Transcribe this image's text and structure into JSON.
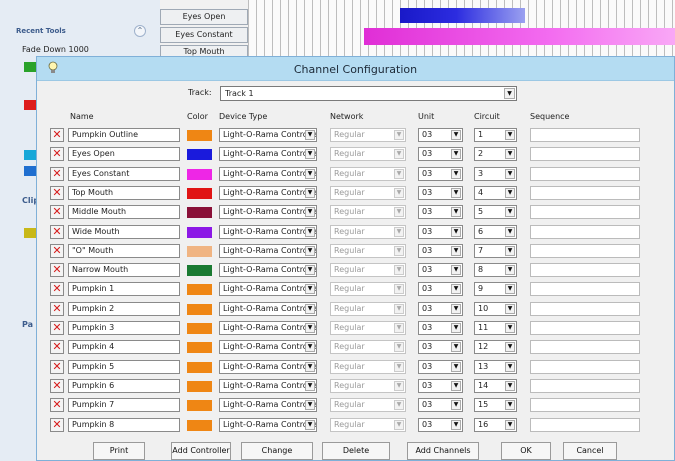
{
  "background": {
    "recent_tools_title": "Recent Tools",
    "recent_tools_collapse": "⌃",
    "recent_tool_item": "Fade Down 1000",
    "channel_rows": [
      "Eyes Open",
      "Eyes Constant",
      "Top Mouth"
    ],
    "clip_label": "Clip",
    "pa_label": "Pa"
  },
  "dialog": {
    "title": "Channel Configuration",
    "track_label": "Track:",
    "track_value": "Track 1",
    "headers": {
      "name": "Name",
      "color": "Color",
      "device_type": "Device Type",
      "network": "Network",
      "unit": "Unit",
      "circuit": "Circuit",
      "sequence": "Sequence"
    },
    "channels": [
      {
        "name": "Pumpkin Outline",
        "color": "#ef8614",
        "device": "Light-O-Rama Controlle",
        "network": "Regular",
        "unit": "03",
        "circuit": "1"
      },
      {
        "name": "Eyes Open",
        "color": "#1a1adc",
        "device": "Light-O-Rama Controlle",
        "network": "Regular",
        "unit": "03",
        "circuit": "2"
      },
      {
        "name": "Eyes Constant",
        "color": "#ee26e6",
        "device": "Light-O-Rama Controlle",
        "network": "Regular",
        "unit": "03",
        "circuit": "3"
      },
      {
        "name": "Top Mouth",
        "color": "#e01414",
        "device": "Light-O-Rama Controlle",
        "network": "Regular",
        "unit": "03",
        "circuit": "4"
      },
      {
        "name": "Middle Mouth",
        "color": "#8a1038",
        "device": "Light-O-Rama Controlle",
        "network": "Regular",
        "unit": "03",
        "circuit": "5"
      },
      {
        "name": "Wide Mouth",
        "color": "#8c18e6",
        "device": "Light-O-Rama Controlle",
        "network": "Regular",
        "unit": "03",
        "circuit": "6"
      },
      {
        "name": "\"O\" Mouth",
        "color": "#f0b482",
        "device": "Light-O-Rama Controlle",
        "network": "Regular",
        "unit": "03",
        "circuit": "7"
      },
      {
        "name": "Narrow Mouth",
        "color": "#1a7a32",
        "device": "Light-O-Rama Controlle",
        "network": "Regular",
        "unit": "03",
        "circuit": "8"
      },
      {
        "name": "Pumpkin 1",
        "color": "#ef8614",
        "device": "Light-O-Rama Controlle",
        "network": "Regular",
        "unit": "03",
        "circuit": "9"
      },
      {
        "name": "Pumpkin 2",
        "color": "#ef8614",
        "device": "Light-O-Rama Controlle",
        "network": "Regular",
        "unit": "03",
        "circuit": "10"
      },
      {
        "name": "Pumpkin 3",
        "color": "#ef8614",
        "device": "Light-O-Rama Controlle",
        "network": "Regular",
        "unit": "03",
        "circuit": "11"
      },
      {
        "name": "Pumpkin 4",
        "color": "#ef8614",
        "device": "Light-O-Rama Controlle",
        "network": "Regular",
        "unit": "03",
        "circuit": "12"
      },
      {
        "name": "Pumpkin 5",
        "color": "#ef8614",
        "device": "Light-O-Rama Controlle",
        "network": "Regular",
        "unit": "03",
        "circuit": "13"
      },
      {
        "name": "Pumpkin 6",
        "color": "#ef8614",
        "device": "Light-O-Rama Controlle",
        "network": "Regular",
        "unit": "03",
        "circuit": "14"
      },
      {
        "name": "Pumpkin 7",
        "color": "#ef8614",
        "device": "Light-O-Rama Controlle",
        "network": "Regular",
        "unit": "03",
        "circuit": "15"
      },
      {
        "name": "Pumpkin 8",
        "color": "#ef8614",
        "device": "Light-O-Rama Controlle",
        "network": "Regular",
        "unit": "03",
        "circuit": "16"
      }
    ],
    "buttons": {
      "print": "Print",
      "add_controller": "Add Controller",
      "change_controller": "Change Controller",
      "delete_controller": "Delete Controller",
      "add_channels": "Add Channels",
      "ok": "OK",
      "cancel": "Cancel"
    }
  }
}
